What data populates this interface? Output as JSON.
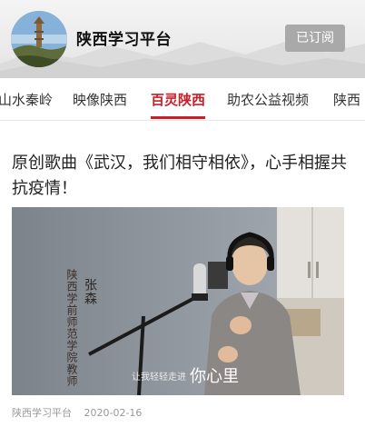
{
  "header": {
    "channel_name": "陕西学习平台",
    "subscribe_label": "已订阅"
  },
  "tabs": [
    {
      "label": "山水秦岭"
    },
    {
      "label": "映像陕西"
    },
    {
      "label": "百灵陕西",
      "active": true
    },
    {
      "label": "助农公益视频"
    },
    {
      "label": "陕西"
    }
  ],
  "article": {
    "title": "原创歌曲《武汉，我们相守相依》，心手相握共抗疫情！",
    "video": {
      "caption_left": "陕西学前师范学院教师",
      "caption_name": "张森",
      "subtitle_small": "让我轻轻走进",
      "subtitle_big": "你心里"
    },
    "source": "陕西学习平台",
    "date": "2020-02-16"
  },
  "colors": {
    "accent": "#c8202a",
    "subscribed_bg": "#a9a9a9"
  }
}
